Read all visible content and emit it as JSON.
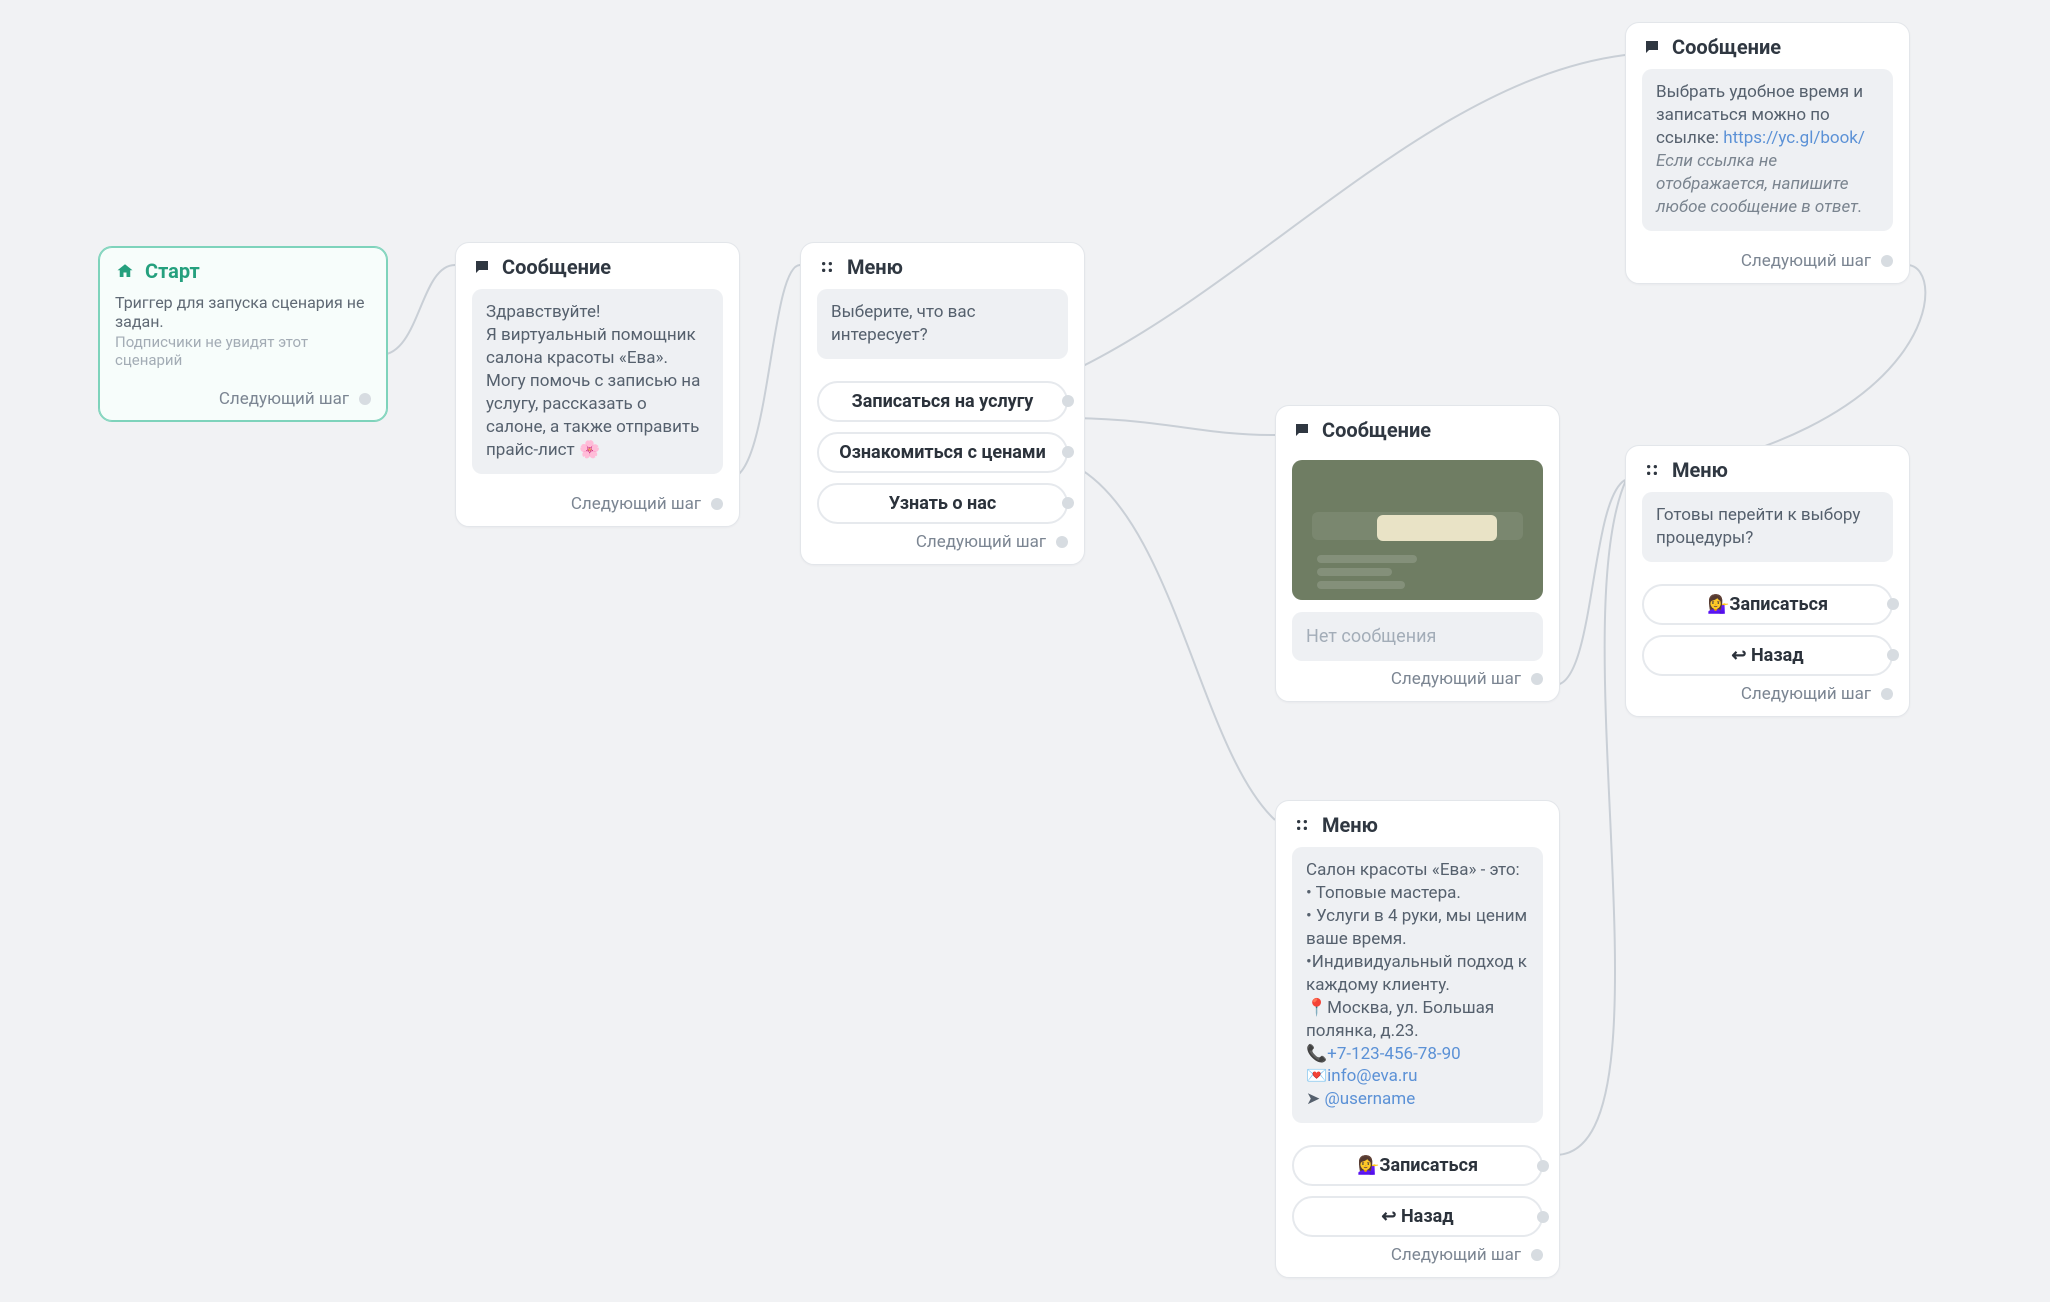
{
  "common": {
    "next_step": "Следующий шаг"
  },
  "start": {
    "title": "Старт",
    "line1": "Триггер для запуска сценария не задан.",
    "line2": "Подписчики не увидят этот сценарий"
  },
  "msg1": {
    "title": "Сообщение",
    "text": "Здравствуйте!\nЯ виртуальный помощник салона красоты «Ева». Могу помочь с записью на услугу, рассказать о салоне, а также отправить прайс-лист 🌸"
  },
  "menu1": {
    "title": "Меню",
    "prompt": "Выберите, что вас интересует?",
    "opt1": "Записаться на услугу",
    "opt2": "Ознакомиться с ценами",
    "opt3": "Узнать о нас"
  },
  "msg2": {
    "title": "Сообщение",
    "pre": "Выбрать удобное время и записаться можно по ссылке: ",
    "link": "https://yc.gl/book/",
    "post": "Если ссылка не отображается, напишите любое сообщение в ответ."
  },
  "msg3": {
    "title": "Сообщение",
    "placeholder": "Нет сообщения"
  },
  "menu2": {
    "title": "Меню",
    "prompt": "Готовы перейти к выбору процедуры?",
    "opt1": "💁‍♀️Записаться",
    "opt2": "↩ Назад"
  },
  "menu3": {
    "title": "Меню",
    "intro": "Салон красоты «Ева» - это:",
    "b1": "• Топовые мастера.",
    "b2": "• Услуги в 4 руки, мы ценим ваше время.",
    "b3": "•Индивидуальный подход к каждому клиенту.",
    "addr": "📍Москва, ул. Большая полянка, д.23.",
    "phone_pre": "📞",
    "phone": "+7-123-456-78-90",
    "mail_pre": "💌",
    "mail": "info@eva.ru",
    "tg_pre": "➤ ",
    "tg": "@username",
    "opt1": "💁‍♀️Записаться",
    "opt2": "↩ Назад"
  }
}
